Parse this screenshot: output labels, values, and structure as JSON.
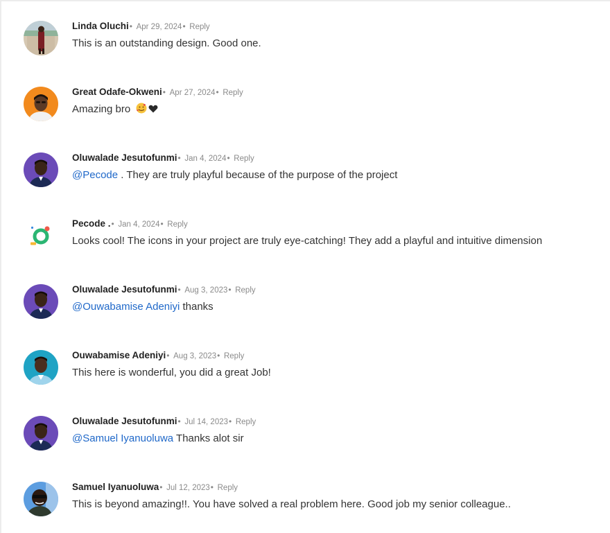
{
  "separator": "•",
  "comments": [
    {
      "author": "Linda Oluchi",
      "date": "Apr 29, 2024",
      "reply": "Reply",
      "mention": "",
      "text": "This is an outstanding design. Good one.",
      "avatar_color": "#c9b9a3"
    },
    {
      "author": "Great Odafe-Okweni",
      "date": "Apr 27, 2024",
      "reply": "Reply",
      "mention": "",
      "text": "Amazing bro",
      "emojis": [
        "face-with-hearts-icon",
        "black-heart-icon"
      ],
      "avatar_color": "#f28a1d"
    },
    {
      "author": "Oluwalade Jesutofunmi",
      "date": "Jan 4, 2024",
      "reply": "Reply",
      "mention": "@Pecode",
      "text": " . They are truly playful because of the purpose of the project",
      "avatar_color": "#6b4bb8"
    },
    {
      "author": "Pecode .",
      "date": "Jan 4, 2024",
      "reply": "Reply",
      "mention": "",
      "text": "Looks cool! The icons in your project are truly eye-catching! They add a playful and intuitive dimension",
      "avatar_color": "#ffffff"
    },
    {
      "author": "Oluwalade Jesutofunmi",
      "date": "Aug 3, 2023",
      "reply": "Reply",
      "mention": "@Ouwabamise Adeniyi",
      "text": " thanks",
      "avatar_color": "#6b4bb8"
    },
    {
      "author": "Ouwabamise Adeniyi",
      "date": "Aug 3, 2023",
      "reply": "Reply",
      "mention": "",
      "text": "This here is wonderful, you did a great Job!",
      "avatar_color": "#1fa3c4"
    },
    {
      "author": "Oluwalade Jesutofunmi",
      "date": "Jul 14, 2023",
      "reply": "Reply",
      "mention": "@Samuel Iyanuoluwa",
      "text": " Thanks alot sir",
      "avatar_color": "#6b4bb8"
    },
    {
      "author": "Samuel Iyanuoluwa",
      "date": "Jul 12, 2023",
      "reply": "Reply",
      "mention": "",
      "text": "This is beyond amazing!!. You have solved a real problem here. Good job my senior colleague..",
      "avatar_color": "#4a90d9"
    }
  ]
}
